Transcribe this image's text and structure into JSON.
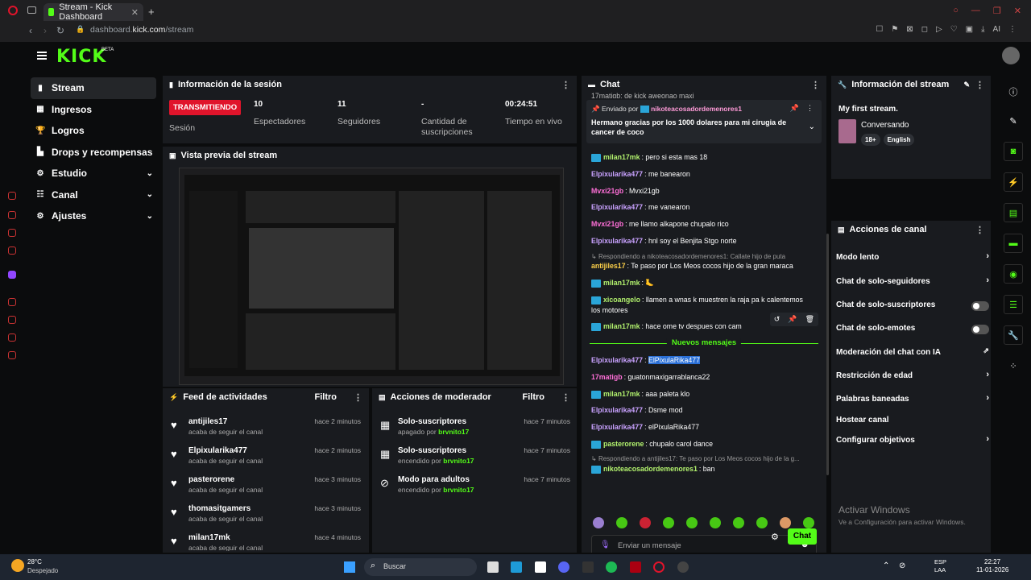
{
  "browser": {
    "tab_title": "Stream - Kick Dashboard",
    "tab_close": "✕",
    "new_tab": "+",
    "url_prefix": "dashboard.",
    "url_domain": "kick.com",
    "url_path": "/stream"
  },
  "app": {
    "logo": "KICK",
    "beta": "BETA"
  },
  "sidebar": {
    "items": [
      {
        "label": "Stream",
        "icon": "stream-icon",
        "glyph": "▮"
      },
      {
        "label": "Ingresos",
        "icon": "money-icon",
        "glyph": "▦"
      },
      {
        "label": "Logros",
        "icon": "trophy-icon",
        "glyph": "🏆"
      },
      {
        "label": "Drops y recompensas",
        "icon": "drops-icon",
        "glyph": "▙"
      },
      {
        "label": "Estudio",
        "icon": "studio-icon",
        "glyph": "⚙"
      },
      {
        "label": "Canal",
        "icon": "channel-icon",
        "glyph": "☷"
      },
      {
        "label": "Ajustes",
        "icon": "settings-icon",
        "glyph": "⚙"
      }
    ]
  },
  "session": {
    "title": "Información de la sesión",
    "live_label": "TRANSMITIENDO",
    "session_label": "Sesión",
    "stats": [
      {
        "value": "10",
        "label": "Espectadores"
      },
      {
        "value": "11",
        "label": "Seguidores"
      },
      {
        "value": "-",
        "label": "Cantidad de suscripciones"
      },
      {
        "value": "00:24:51",
        "label": "Tiempo en vivo"
      }
    ]
  },
  "preview": {
    "title": "Vista previa del stream"
  },
  "feed": {
    "title": "Feed de actividades",
    "filter": "Filtro",
    "items": [
      {
        "name": "antijiles17",
        "sub": "acaba de seguir el canal",
        "time": "hace 2 minutos"
      },
      {
        "name": "Elpixularika477",
        "sub": "acaba de seguir el canal",
        "time": "hace 2 minutos"
      },
      {
        "name": "pasterorene",
        "sub": "acaba de seguir el canal",
        "time": "hace 3 minutos"
      },
      {
        "name": "thomasitgamers",
        "sub": "acaba de seguir el canal",
        "time": "hace 3 minutos"
      },
      {
        "name": "milan17mk",
        "sub": "acaba de seguir el canal",
        "time": "hace 4 minutos"
      }
    ]
  },
  "mod_actions": {
    "title": "Acciones de moderador",
    "filter": "Filtro",
    "items": [
      {
        "name": "Solo-suscriptores",
        "state": "apagado por",
        "by": "brvnito17",
        "time": "hace 7 minutos"
      },
      {
        "name": "Solo-suscriptores",
        "state": "encendido por",
        "by": "brvnito17",
        "time": "hace 7 minutos"
      },
      {
        "name": "Modo para adultos",
        "state": "encendido por",
        "by": "brvnito17",
        "time": "hace 7 minutos"
      }
    ]
  },
  "chat": {
    "title": "Chat",
    "top_cut": "17matigb: de kick aweonao maxi",
    "pinned_by_label": "Enviado por",
    "pinned_user": "nikoteacosadordemenores1",
    "pinned_text": "Hermano gracias por los 1000 dolares para mi cirugia de cancer de coco",
    "messages": [
      {
        "user": "milan17mk",
        "color": "#b3f36e",
        "badge": true,
        "text": "pero si esta mas 18"
      },
      {
        "user": "Elpixularika477",
        "color": "#c9a2ff",
        "badge": false,
        "text": "me banearon"
      },
      {
        "user": "Mvxi21gb",
        "color": "#ff6fd8",
        "badge": false,
        "text": "Mvxi21gb"
      },
      {
        "user": "Elpixularika477",
        "color": "#c9a2ff",
        "badge": false,
        "text": "me vanearon"
      },
      {
        "user": "Mvxi21gb",
        "color": "#ff6fd8",
        "badge": false,
        "text": "me llamo alkapone chupalo rico"
      },
      {
        "user": "Elpixularika477",
        "color": "#c9a2ff",
        "badge": false,
        "text": "hnl soy el Benjita Stgo norte"
      },
      {
        "user": "antijiles17",
        "color": "#ffd24a",
        "badge": false,
        "text": "Te paso por Los Meos cocos hijo de la gran maraca"
      },
      {
        "user": "milan17mk",
        "color": "#b3f36e",
        "badge": true,
        "text": "🦶"
      },
      {
        "user": "xicoangelo",
        "color": "#b3f36e",
        "badge": true,
        "text": "llamen a wnas k muestren la raja pa k calentemos"
      },
      {
        "user": "milan17mk",
        "color": "#b3f36e",
        "badge": true,
        "text": "hace ome tv despues con cam"
      },
      {
        "user": "Elpixularika477",
        "color": "#c9a2ff",
        "badge": false,
        "text": "ElPixulaRika477"
      },
      {
        "user": "17matigb",
        "color": "#ff6fd8",
        "badge": false,
        "text": "guatonmaxigarrablanca22"
      },
      {
        "user": "milan17mk",
        "color": "#b3f36e",
        "badge": true,
        "text": "aaa paleta klo"
      },
      {
        "user": "Elpixularika477",
        "color": "#c9a2ff",
        "badge": false,
        "text": "Dsme mod"
      },
      {
        "user": "Elpixularika477",
        "color": "#c9a2ff",
        "badge": false,
        "text": "elPixulaRika477"
      },
      {
        "user": "pasterorene",
        "color": "#b3f36e",
        "badge": true,
        "text": "chupalo carol dance"
      },
      {
        "user": "nikoteacosadordemenores1",
        "color": "#b3f36e",
        "badge": true,
        "text": "ban"
      }
    ],
    "motores": "los motores",
    "reply1": "Respondiendo a nikoteacosadordemenores1: Callate hijo de puta",
    "reply2": "Respondiendo a antijiles17: Te paso por Los Meos cocos hijo de la g...",
    "new_messages": "Nuevos mensajes",
    "input_placeholder": "Enviar un mensaje",
    "send": "Chat"
  },
  "stream_info": {
    "title": "Información del stream",
    "stream_title": "My first stream.",
    "category": "Conversando",
    "tags": [
      "18+",
      "English"
    ]
  },
  "channel_actions": {
    "title": "Acciones de canal",
    "items": [
      {
        "label": "Modo lento",
        "kind": "arrow"
      },
      {
        "label": "Chat de solo-seguidores",
        "kind": "arrow"
      },
      {
        "label": "Chat de solo-suscriptores",
        "kind": "toggle"
      },
      {
        "label": "Chat de solo-emotes",
        "kind": "toggle"
      },
      {
        "label": "Moderación del chat con IA",
        "kind": "external"
      },
      {
        "label": "Restricción de edad",
        "kind": "arrow"
      },
      {
        "label": "Palabras baneadas",
        "kind": "arrow"
      },
      {
        "label": "Hostear canal",
        "kind": "none"
      },
      {
        "label": "Configurar objetivos",
        "kind": "arrow"
      }
    ]
  },
  "windows_watermark": {
    "title": "Activar Windows",
    "sub": "Ve a Configuración para activar Windows."
  },
  "taskbar": {
    "temp": "28°C",
    "weather": "Despejado",
    "search": "Buscar",
    "lang1": "ESP",
    "lang2": "LAA",
    "time": "22:27",
    "date": "11-01-2026"
  },
  "colors": {
    "accent": "#53fc18",
    "live": "#e0142b",
    "panel": "#191b1f"
  }
}
